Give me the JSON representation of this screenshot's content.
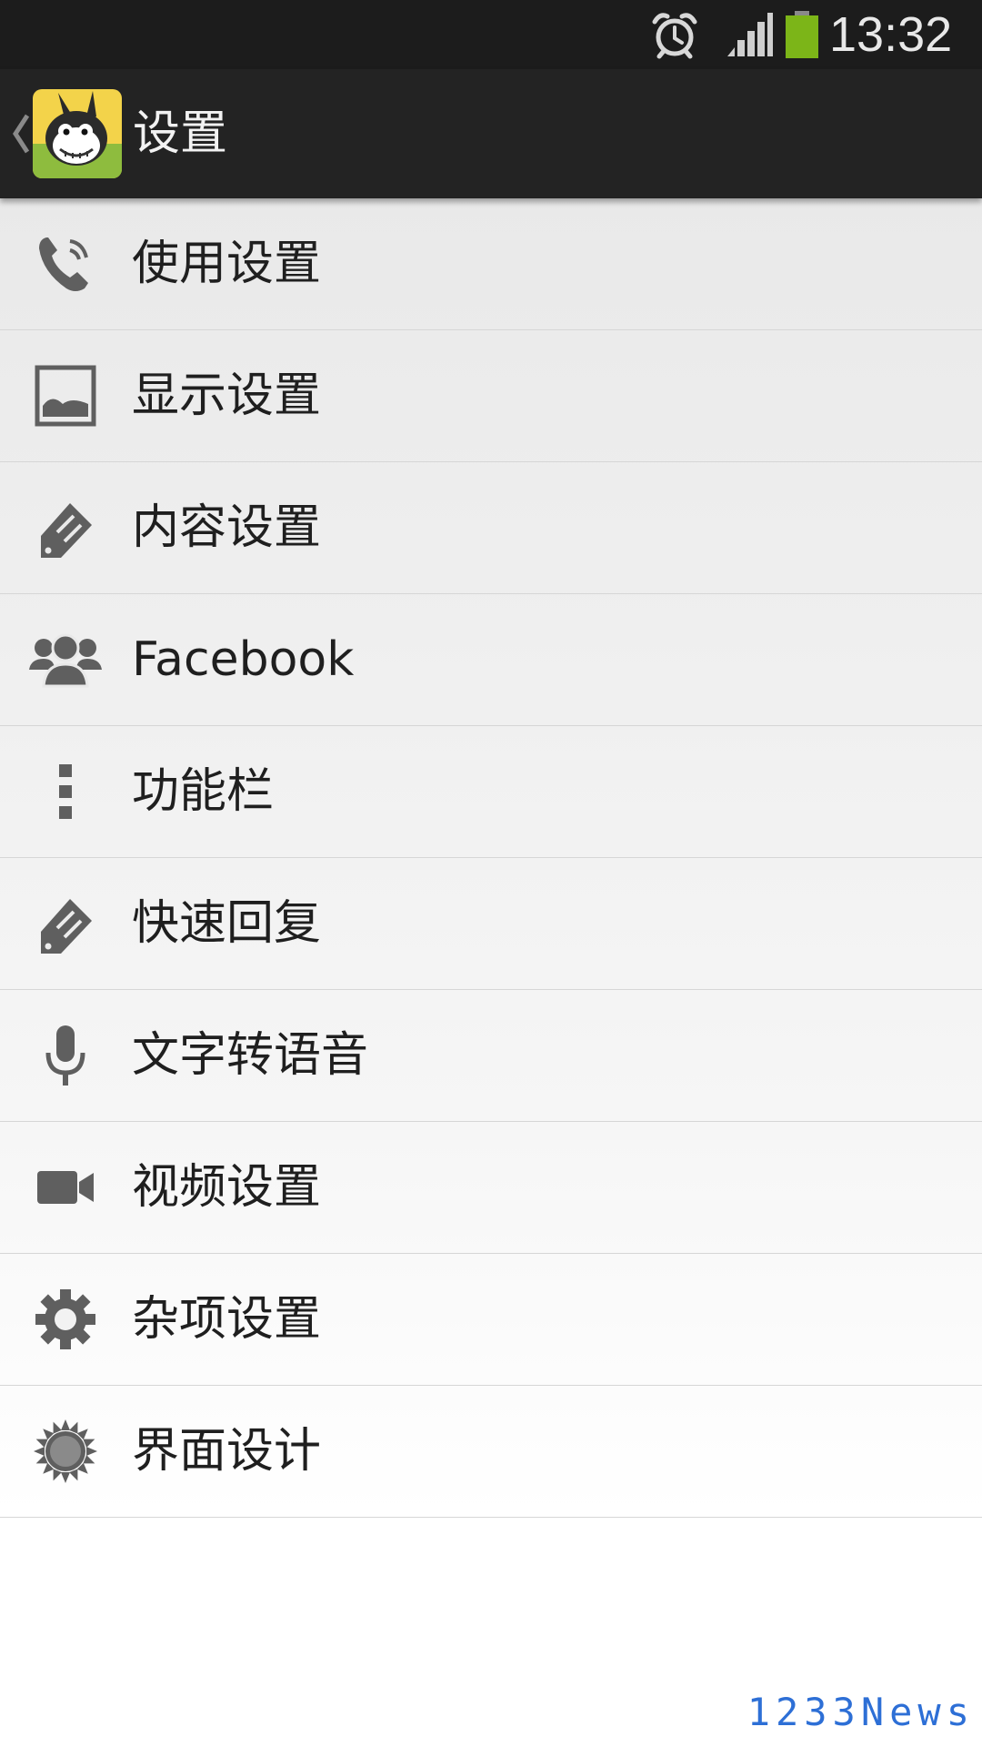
{
  "status_bar": {
    "time": "13:32",
    "icons": [
      "alarm-icon",
      "signal-icon",
      "battery-icon"
    ],
    "battery_color": "#7cb518"
  },
  "action_bar": {
    "title": "设置",
    "back_icon": "chevron-left-icon",
    "app_icon": "app-logo-icon"
  },
  "menu": {
    "items": [
      {
        "label": "使用设置",
        "icon": "phone-icon"
      },
      {
        "label": "显示设置",
        "icon": "image-icon"
      },
      {
        "label": "内容设置",
        "icon": "tag-icon"
      },
      {
        "label": "Facebook",
        "icon": "group-icon"
      },
      {
        "label": "功能栏",
        "icon": "more-vertical-icon"
      },
      {
        "label": "快速回复",
        "icon": "tag-icon"
      },
      {
        "label": "文字转语音",
        "icon": "microphone-icon"
      },
      {
        "label": "视频设置",
        "icon": "video-camera-icon"
      },
      {
        "label": "杂项设置",
        "icon": "gear-icon"
      },
      {
        "label": "界面设计",
        "icon": "sun-icon"
      }
    ]
  },
  "watermark": "1233News"
}
